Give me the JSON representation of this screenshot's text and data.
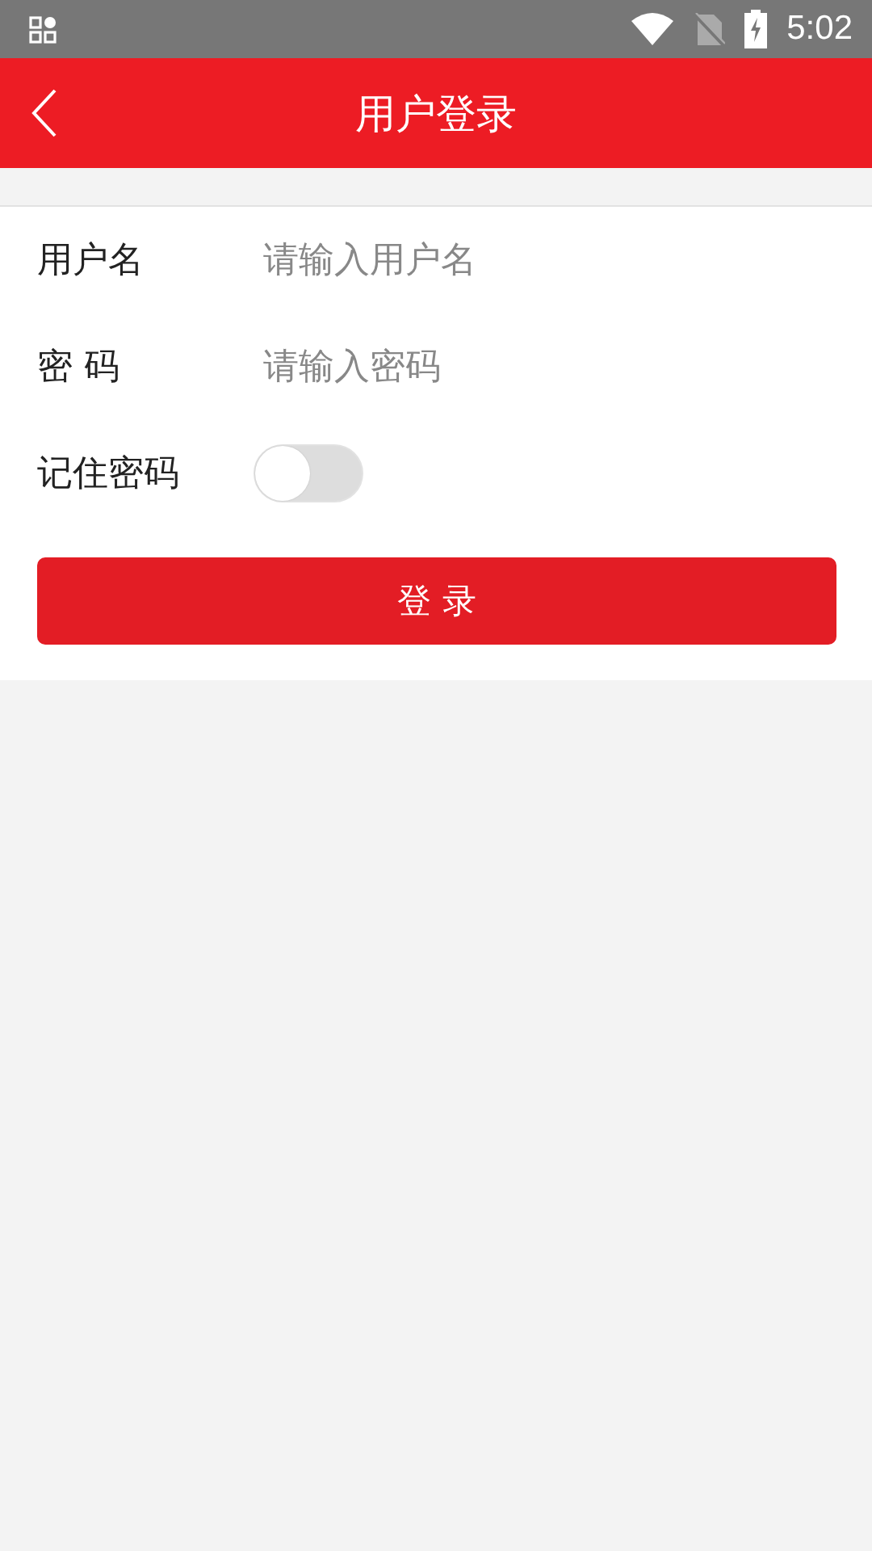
{
  "status_bar": {
    "time": "5:02"
  },
  "header": {
    "title": "用户登录"
  },
  "fields": [
    {
      "label": "用户名",
      "placeholder": "请输入用户名"
    },
    {
      "label": "密 码",
      "placeholder": "请输入密码"
    }
  ],
  "remember": {
    "label": "记住密码",
    "on": false
  },
  "login_button": {
    "label": "登 录"
  }
}
